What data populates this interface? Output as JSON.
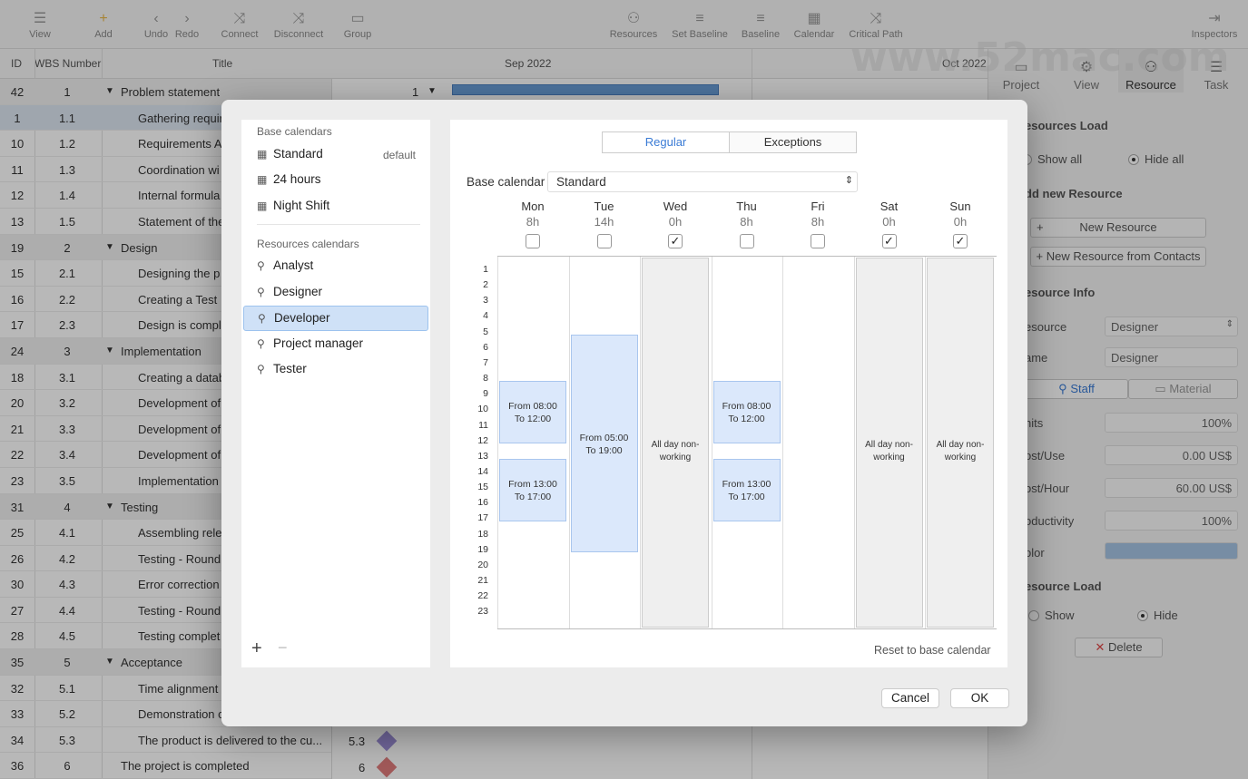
{
  "toolbar": {
    "items": [
      {
        "label": "View",
        "icon": "view-icon"
      },
      {
        "label": "Add",
        "icon": "plus-icon"
      },
      {
        "label": "Undo",
        "icon": "undo-icon"
      },
      {
        "label": "Redo",
        "icon": "redo-icon"
      },
      {
        "label": "Connect",
        "icon": "connect-icon"
      },
      {
        "label": "Disconnect",
        "icon": "disconnect-icon"
      },
      {
        "label": "Group",
        "icon": "group-icon"
      },
      {
        "label": "Resources",
        "icon": "resources-icon"
      },
      {
        "label": "Set Baseline",
        "icon": "set-baseline-icon"
      },
      {
        "label": "Baseline",
        "icon": "baseline-icon"
      },
      {
        "label": "Calendar",
        "icon": "calendar-icon"
      },
      {
        "label": "Critical Path",
        "icon": "critical-path-icon"
      },
      {
        "label": "Inspectors",
        "icon": "inspectors-icon"
      }
    ]
  },
  "table": {
    "headers": {
      "id": "ID",
      "wbs": "WBS Number",
      "title": "Title"
    },
    "rows": [
      {
        "id": "42",
        "wbs": "1",
        "title": "Problem statement",
        "summary": true
      },
      {
        "id": "1",
        "wbs": "1.1",
        "title": "Gathering requir",
        "summary": false
      },
      {
        "id": "10",
        "wbs": "1.2",
        "title": "Requirements A",
        "summary": false
      },
      {
        "id": "11",
        "wbs": "1.3",
        "title": "Coordination wi",
        "summary": false
      },
      {
        "id": "12",
        "wbs": "1.4",
        "title": "Internal formula",
        "summary": false
      },
      {
        "id": "13",
        "wbs": "1.5",
        "title": "Statement of the",
        "summary": false
      },
      {
        "id": "19",
        "wbs": "2",
        "title": "Design",
        "summary": true
      },
      {
        "id": "15",
        "wbs": "2.1",
        "title": "Designing the p",
        "summary": false
      },
      {
        "id": "16",
        "wbs": "2.2",
        "title": "Creating a Test",
        "summary": false
      },
      {
        "id": "17",
        "wbs": "2.3",
        "title": "Design is compl",
        "summary": false
      },
      {
        "id": "24",
        "wbs": "3",
        "title": "Implementation",
        "summary": true
      },
      {
        "id": "18",
        "wbs": "3.1",
        "title": "Creating a datab",
        "summary": false
      },
      {
        "id": "20",
        "wbs": "3.2",
        "title": "Development of",
        "summary": false
      },
      {
        "id": "21",
        "wbs": "3.3",
        "title": "Development of",
        "summary": false
      },
      {
        "id": "22",
        "wbs": "3.4",
        "title": "Development of",
        "summary": false
      },
      {
        "id": "23",
        "wbs": "3.5",
        "title": "Implementation",
        "summary": false
      },
      {
        "id": "31",
        "wbs": "4",
        "title": "Testing",
        "summary": true
      },
      {
        "id": "25",
        "wbs": "4.1",
        "title": "Assembling rele",
        "summary": false
      },
      {
        "id": "26",
        "wbs": "4.2",
        "title": "Testing - Round",
        "summary": false
      },
      {
        "id": "30",
        "wbs": "4.3",
        "title": "Error correction",
        "summary": false
      },
      {
        "id": "27",
        "wbs": "4.4",
        "title": "Testing - Round",
        "summary": false
      },
      {
        "id": "28",
        "wbs": "4.5",
        "title": "Testing complet",
        "summary": false
      },
      {
        "id": "35",
        "wbs": "5",
        "title": "Acceptance",
        "summary": true
      },
      {
        "id": "32",
        "wbs": "5.1",
        "title": "Time alignment",
        "summary": false
      },
      {
        "id": "33",
        "wbs": "5.2",
        "title": "Demonstration c",
        "summary": false
      },
      {
        "id": "34",
        "wbs": "5.3",
        "title": "The product is delivered to the cu...",
        "summary": false
      },
      {
        "id": "36",
        "wbs": "6",
        "title": "The project is completed",
        "summary": false
      }
    ]
  },
  "gantt": {
    "month1": "Sep 2022",
    "month2": "Oct 2022",
    "label_top": "1",
    "label_53": "5.3",
    "label_6": "6"
  },
  "inspector": {
    "tabs": [
      "Project",
      "View",
      "Resource",
      "Task"
    ],
    "resources_load": "esources Load",
    "show_all": "Show all",
    "hide_all": "Hide all",
    "add_new_resource": "dd new Resource",
    "new_resource": "New Resource",
    "new_resource_contacts": "+ New Resource from Contacts",
    "resource_info": "esource Info",
    "resource_label": "esource",
    "resource_value": "Designer",
    "name_label": "ame",
    "name_value": "Designer",
    "staff": "Staff",
    "material": "Material",
    "units_label": "nits",
    "units_value": "100%",
    "cost_use_label": "ost/Use",
    "cost_use_value": "0.00 US$",
    "cost_hour_label": "ost/Hour",
    "cost_hour_value": "60.00 US$",
    "productivity_label": "oductivity",
    "productivity_value": "100%",
    "color_label": "olor",
    "color_value": "#a6c4e4",
    "resource_load2": "esource Load",
    "show": "Show",
    "hide": "Hide",
    "delete": "Delete"
  },
  "watermark": {
    "text": "www.52mac.com"
  },
  "dialog": {
    "base_calendars_title": "Base calendars",
    "base_calendars": [
      {
        "name": "Standard",
        "badge": "default"
      },
      {
        "name": "24 hours",
        "badge": ""
      },
      {
        "name": "Night Shift",
        "badge": ""
      }
    ],
    "resource_calendars_title": "Resources calendars",
    "resource_calendars": [
      "Analyst",
      "Designer",
      "Developer",
      "Project manager",
      "Tester"
    ],
    "selected": "Developer",
    "segments": [
      "Regular",
      "Exceptions"
    ],
    "base_calendar_label": "Base calendar",
    "base_calendar_value": "Standard",
    "days": [
      {
        "name": "Mon",
        "hours": "8h",
        "nonworking": false
      },
      {
        "name": "Tue",
        "hours": "14h",
        "nonworking": false
      },
      {
        "name": "Wed",
        "hours": "0h",
        "nonworking": true
      },
      {
        "name": "Thu",
        "hours": "8h",
        "nonworking": false
      },
      {
        "name": "Fri",
        "hours": "8h",
        "nonworking": false
      },
      {
        "name": "Sat",
        "hours": "0h",
        "nonworking": true
      },
      {
        "name": "Sun",
        "hours": "0h",
        "nonworking": true
      }
    ],
    "hours": [
      "1",
      "2",
      "3",
      "4",
      "5",
      "6",
      "7",
      "8",
      "9",
      "10",
      "11",
      "12",
      "13",
      "14",
      "15",
      "16",
      "17",
      "18",
      "19",
      "20",
      "21",
      "22",
      "23"
    ],
    "blocks": {
      "mon_am": [
        "From 08:00",
        "To 12:00"
      ],
      "mon_pm": [
        "From 13:00",
        "To 17:00"
      ],
      "tue": [
        "From 05:00",
        "To 19:00"
      ],
      "thu_am": [
        "From 08:00",
        "To 12:00"
      ],
      "thu_pm": [
        "From 13:00",
        "To 17:00"
      ],
      "nonworking": [
        "All day non-",
        "working"
      ]
    },
    "reset": "Reset to base calendar",
    "cancel": "Cancel",
    "ok": "OK"
  }
}
